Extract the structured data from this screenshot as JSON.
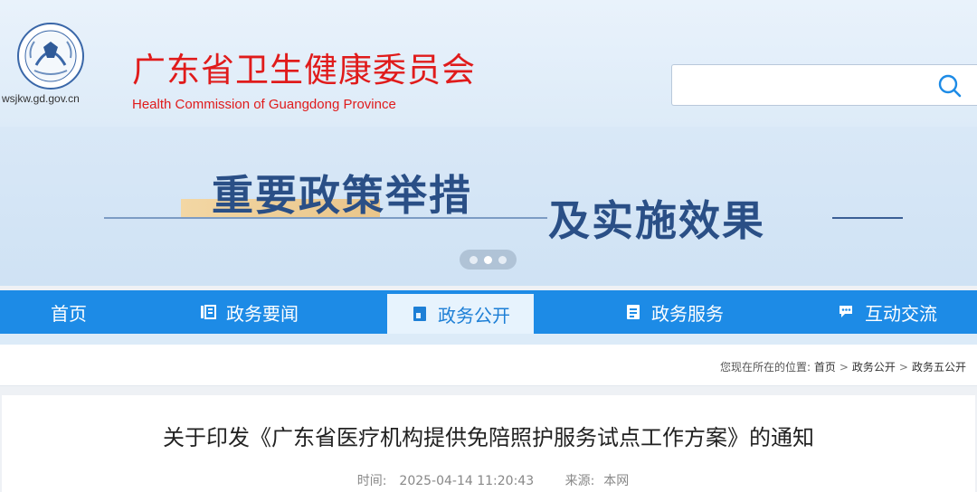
{
  "header": {
    "domain": "wsjkw.gd.gov.cn",
    "title": "广东省卫生健康委员会",
    "subtitle": "Health Commission of Guangdong Province",
    "search_placeholder": "",
    "icons": {
      "logo": "commission-emblem",
      "search": "search-icon"
    }
  },
  "banner": {
    "text_1": "重要政策举措",
    "text_2": "及实施效果",
    "carousel_dots": 3,
    "carousel_active": 1
  },
  "nav": {
    "items": [
      {
        "label": "首页",
        "icon": ""
      },
      {
        "label": "政务要闻",
        "icon": "news-list-icon"
      },
      {
        "label": "政务公开",
        "icon": "book-icon"
      },
      {
        "label": "政务服务",
        "icon": "document-icon"
      },
      {
        "label": "互动交流",
        "icon": "chat-icon"
      }
    ],
    "active_index": 2
  },
  "breadcrumb": {
    "prefix": "您现在所在的位置:",
    "items": [
      "首页",
      "政务公开",
      "政务五公开"
    ],
    "separator": ">"
  },
  "article": {
    "title": "关于印发《广东省医疗机构提供免陪照护服务试点工作方案》的通知",
    "time_label": "时间:",
    "time_value": "2025-04-14 11:20:43",
    "source_label": "来源:",
    "source_value": "本网"
  },
  "colors": {
    "brand_red": "#e01b1b",
    "nav_blue": "#1d8be6",
    "banner_text": "#2a4f86"
  }
}
